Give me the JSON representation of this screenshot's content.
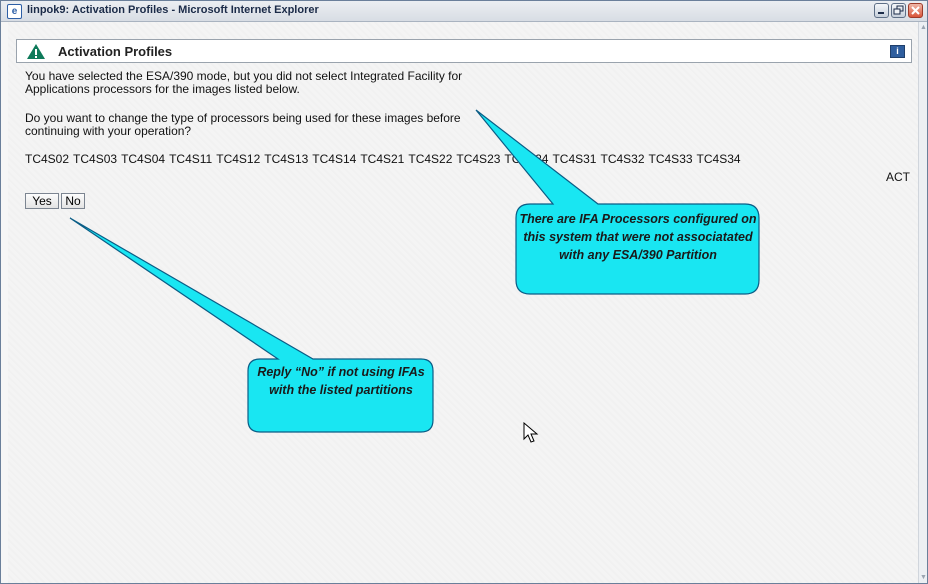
{
  "window": {
    "title": "linpok9: Activation Profiles - Microsoft Internet Explorer"
  },
  "panel": {
    "title": "Activation Profiles",
    "info_icon": "i"
  },
  "message": {
    "line1": "You have selected the ESA/390 mode, but you did not select Integrated Facility for Applications processors for the images listed below.",
    "line2": "Do you want to change the type of processors being used for these images before continuing with your operation?"
  },
  "images": [
    "TC4S02",
    "TC4S03",
    "TC4S04",
    "TC4S11",
    "TC4S12",
    "TC4S13",
    "TC4S14",
    "TC4S21",
    "TC4S22",
    "TC4S23",
    "TC4S24",
    "TC4S31",
    "TC4S32",
    "TC4S33",
    "TC4S34"
  ],
  "trailing_image": "ACT",
  "buttons": {
    "yes": "Yes",
    "no": "No"
  },
  "callouts": {
    "ifa": "There are IFA Processors configured on this system that were not associatated with any ESA/390 Partition",
    "reply": "Reply “No” if not using IFAs with the listed partitions"
  },
  "colors": {
    "callout_fill": "#19e6f2",
    "callout_border": "#0a5d86",
    "warning": "#0e7a5a"
  }
}
